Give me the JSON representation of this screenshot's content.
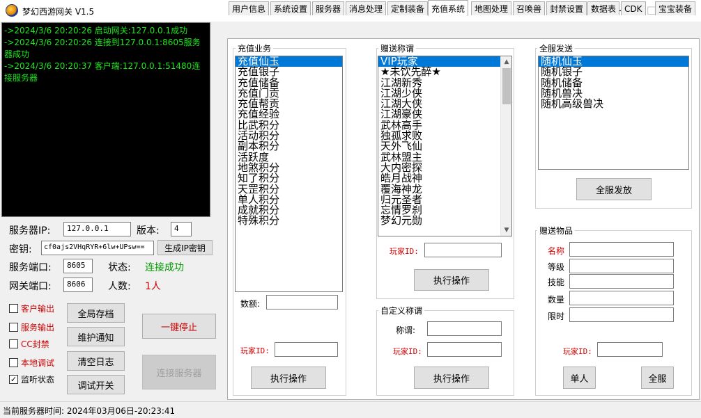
{
  "window": {
    "title": "梦幻西游网关 V1.5",
    "min": "─",
    "max": "☐",
    "close": "✕"
  },
  "log": [
    "->2024/3/6 20:20:26    启动网关:127.0.0.1成功",
    "->2024/3/6 20:20:26    连接到127.0.0.1:8605服务器成功",
    "->2024/3/6 20:20:37    客户端:127.0.0.1:51480连接服务器"
  ],
  "server": {
    "ip_label": "服务器IP:",
    "ip": "127.0.0.1",
    "version_label": "版本:",
    "version": "4",
    "key_label": "密钥:",
    "key": "cf0ajs2VHqRYR+6lw+UPsw==",
    "gen_key": "生成IP密钥",
    "port_label": "服务端口:",
    "port": "8605",
    "status_label": "状态:",
    "status": "连接成功",
    "gateway_label": "网关端口:",
    "gateway_port": "8606",
    "count_label": "人数:",
    "count": "1人"
  },
  "checks": [
    {
      "label": "客户输出",
      "checked": false,
      "color": "red"
    },
    {
      "label": "服务输出",
      "checked": false,
      "color": "red"
    },
    {
      "label": "CC封禁",
      "checked": false,
      "color": "red"
    },
    {
      "label": "本地调试",
      "checked": false,
      "color": "red"
    },
    {
      "label": "监听状态",
      "checked": true,
      "color": "black"
    }
  ],
  "buttons": {
    "save_all": "全局存档",
    "maint": "维护通知",
    "clear_log": "清空日志",
    "debug": "调试开关",
    "stop": "一键停止",
    "connect": "连接服务器"
  },
  "tabs": [
    "用户信息",
    "系统设置",
    "服务器",
    "消息处理",
    "定制装备",
    "充值系统",
    "地图处理",
    "召唤兽",
    "封禁设置",
    "数据表",
    "CDK",
    "宝宝装备"
  ],
  "active_tab": "充值系统",
  "recharge": {
    "title": "充值业务",
    "items": [
      "充值仙玉",
      "充值银子",
      "充值储备",
      "充值门贡",
      "充值帮贡",
      "充值经验",
      "比武积分",
      "活动积分",
      "副本积分",
      "活跃度",
      "地煞积分",
      "知了积分",
      "天罡积分",
      "单人积分",
      "成就积分",
      "特殊积分"
    ],
    "amount_label": "数额:",
    "player_label": "玩家ID:",
    "exec": "执行操作"
  },
  "title_gift": {
    "title": "赠送称谓",
    "items": [
      "VIP玩家",
      "★未饮先醉★",
      "江湖新秀",
      "江湖少侠",
      "江湖大侠",
      "江湖豪侠",
      "武林高手",
      "独孤求败",
      "天外飞仙",
      "武林盟主",
      "大内密探",
      "皓月战神",
      "覆海神龙",
      "归元圣者",
      "忘情罗刹",
      "梦幻元勋"
    ],
    "player_label": "玩家ID:",
    "exec": "执行操作"
  },
  "custom_title": {
    "title": "自定义称谓",
    "name_label": "称谓:",
    "player_label": "玩家ID:",
    "exec": "执行操作"
  },
  "server_send": {
    "title": "全服发送",
    "items": [
      "随机仙玉",
      "随机银子",
      "随机储备",
      "随机兽决",
      "随机高级兽决"
    ],
    "send": "全服发放"
  },
  "gift_item": {
    "title": "赠送物品",
    "fields": [
      {
        "label": "名称",
        "color": "red"
      },
      {
        "label": "等级",
        "color": "black"
      },
      {
        "label": "技能",
        "color": "black"
      },
      {
        "label": "数量",
        "color": "black"
      },
      {
        "label": "限时",
        "color": "black"
      }
    ],
    "player_label": "玩家ID:",
    "single": "单人",
    "all": "全服"
  },
  "status_bar": "当前服务器时间:  2024年03月06日-20:23:41"
}
